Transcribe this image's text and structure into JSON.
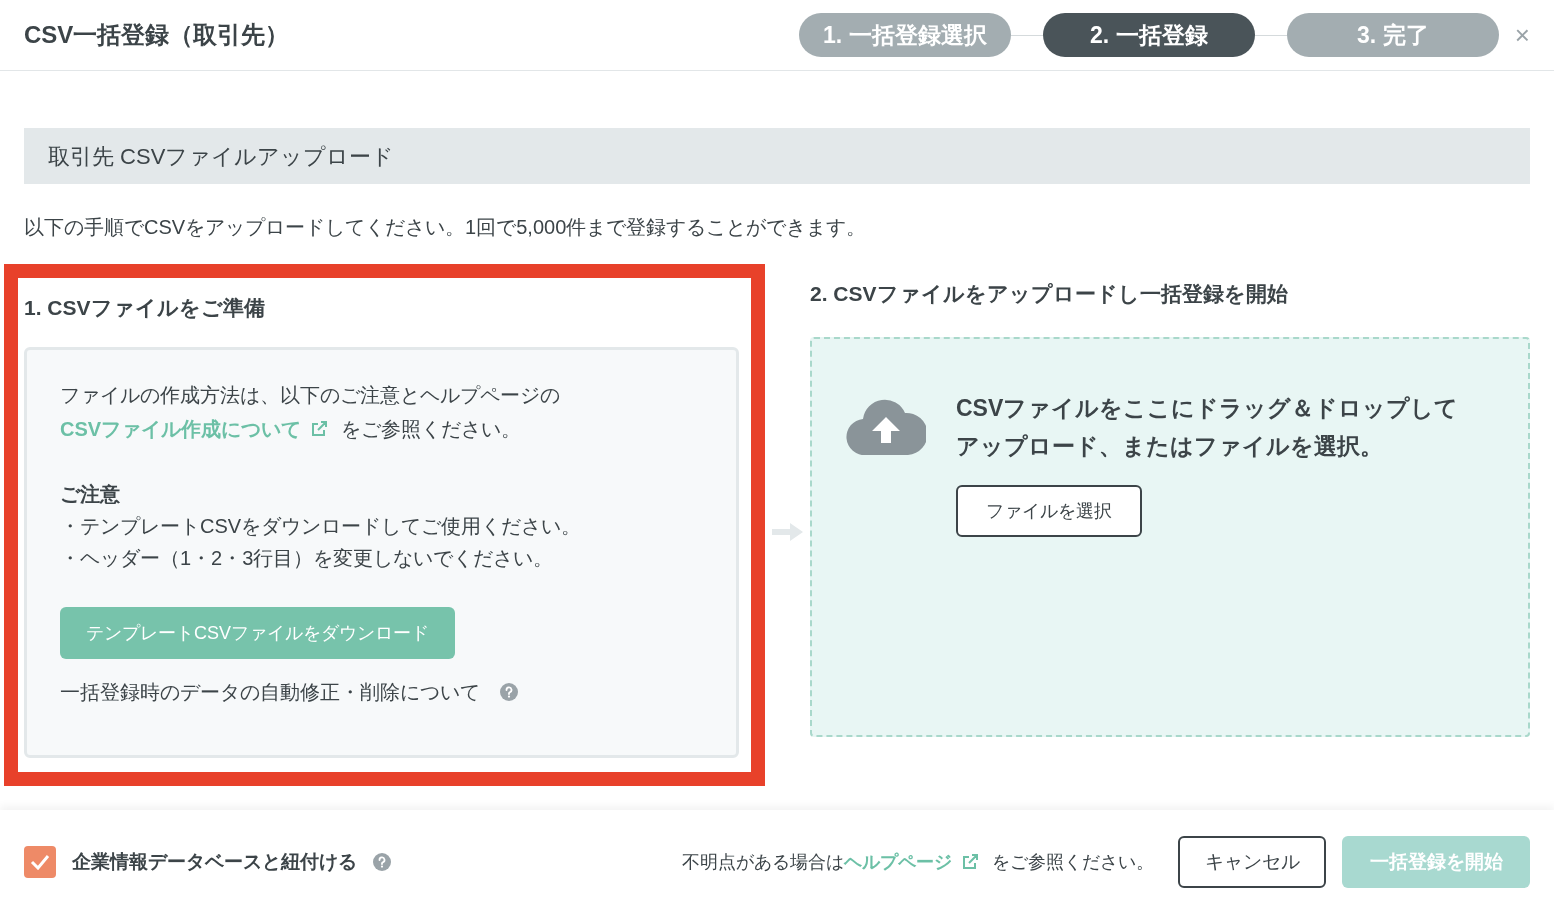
{
  "dialog": {
    "title": "CSV一括登録（取引先）",
    "close": "×"
  },
  "steps": [
    {
      "label": "1. 一括登録選択",
      "selected": false
    },
    {
      "label": "2. 一括登録",
      "selected": true
    },
    {
      "label": "3. 完了",
      "selected": false
    }
  ],
  "section_title": "取引先 CSVファイルアップロード",
  "intro": "以下の手順でCSVをアップロードしてください。1回で5,000件まで登録することができます。",
  "prepare": {
    "highlighted": true,
    "heading": "1. CSVファイルをご準備",
    "text_before": "ファイルの作成方法は、以下のご注意とヘルプページの",
    "link": "CSVファイル作成について",
    "text_after": "をご参照ください。",
    "notice_title": "ご注意",
    "notices": [
      "・テンプレートCSVをダウンロードしてご使用ください。",
      "・ヘッダー（1・2・3行目）を変更しないでください。"
    ],
    "download_button": "テンプレートCSVファイルをダウンロード",
    "auto_fix_link": "一括登録時のデータの自動修正・削除について"
  },
  "upload": {
    "heading": "2. CSVファイルをアップロードし一括登録を開始",
    "drop_text_lines": [
      "CSVファイルをここにドラッグ＆ドロップして",
      "アップロード、またはファイルを選択。"
    ],
    "select_button": "ファイルを選択"
  },
  "footer": {
    "link_checkbox": {
      "label": "企業情報データベースと紐付ける",
      "checked": true
    },
    "help_before": "不明点がある場合は",
    "help_link": "ヘルプページ",
    "help_after": "をご参照ください。",
    "cancel": "キャンセル",
    "start": {
      "label": "一括登録を開始",
      "disabled": true
    }
  }
}
